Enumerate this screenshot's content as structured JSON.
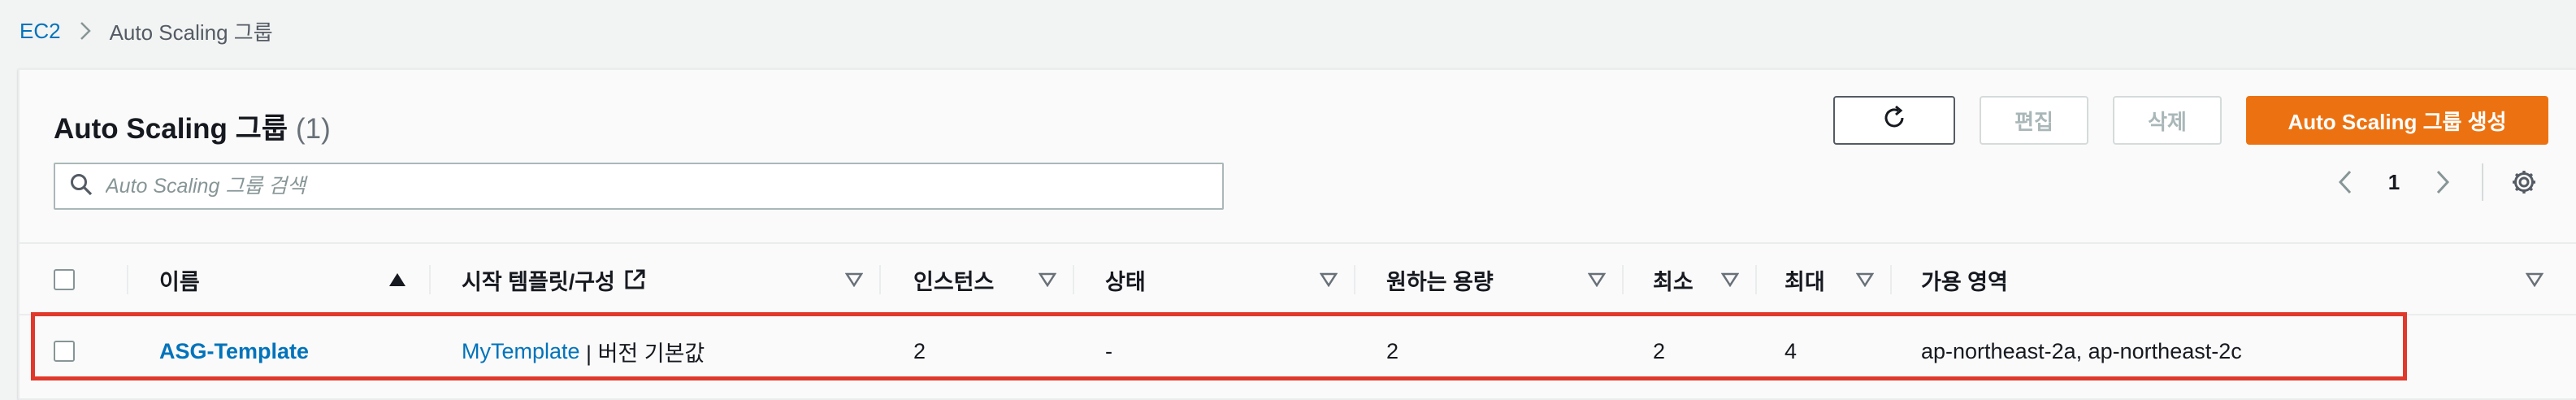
{
  "breadcrumb": {
    "root": "EC2",
    "current": "Auto Scaling 그룹"
  },
  "panel": {
    "title": "Auto Scaling 그룹",
    "count": "(1)"
  },
  "actions": {
    "edit": "편집",
    "delete": "삭제",
    "create": "Auto Scaling 그룹 생성"
  },
  "search": {
    "placeholder": "Auto Scaling 그룹 검색"
  },
  "pagination": {
    "page": "1"
  },
  "columns": {
    "name": "이름",
    "template": "시작 템플릿/구성",
    "instances": "인스턴스",
    "status": "상태",
    "desired": "원하는 용량",
    "min": "최소",
    "max": "최대",
    "az": "가용 영역"
  },
  "rows": [
    {
      "name": "ASG-Template",
      "template_link": "MyTemplate",
      "template_suffix": " | 버전 기본값",
      "instances": "2",
      "status": "-",
      "desired": "2",
      "min": "2",
      "max": "4",
      "az": "ap-northeast-2a, ap-northeast-2c"
    }
  ],
  "colors": {
    "primary": "#ec7211",
    "link": "#0073bb",
    "highlight": "#e0392b"
  }
}
